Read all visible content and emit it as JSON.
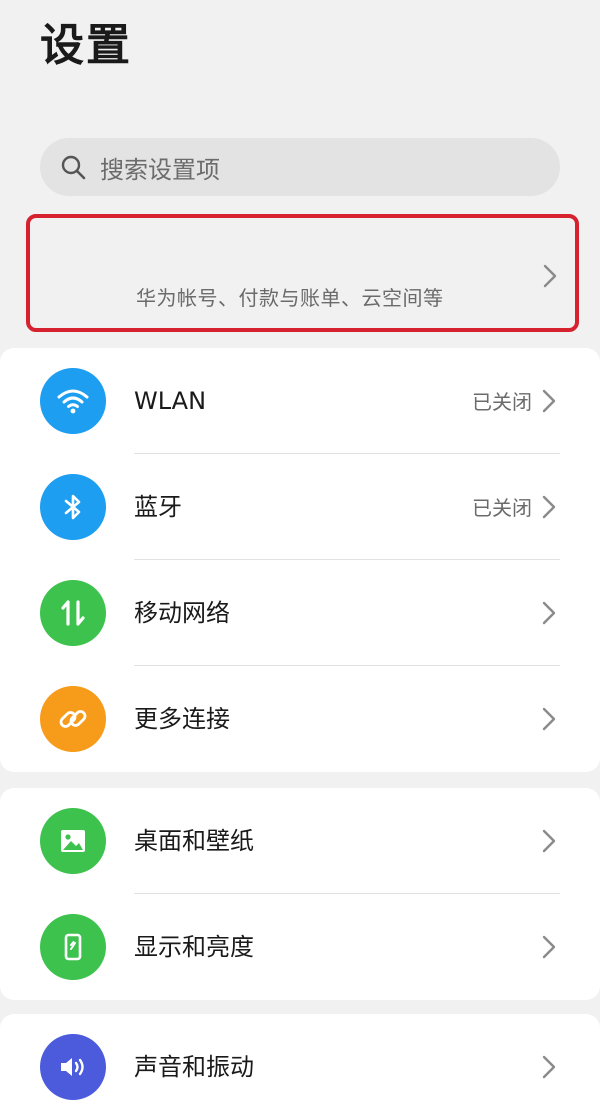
{
  "header": {
    "title": "设置"
  },
  "search": {
    "placeholder": "搜索设置项"
  },
  "account": {
    "subtitle": "华为帐号、付款与账单、云空间等"
  },
  "groups": [
    {
      "items": [
        {
          "label": "WLAN",
          "status": "已关闭",
          "icon": "wifi-icon",
          "color": "#1e9ef0"
        },
        {
          "label": "蓝牙",
          "status": "已关闭",
          "icon": "bluetooth-icon",
          "color": "#1e9ef0"
        },
        {
          "label": "移动网络",
          "status": "",
          "icon": "mobile-data-icon",
          "color": "#3ec24e"
        },
        {
          "label": "更多连接",
          "status": "",
          "icon": "link-icon",
          "color": "#f79b1a"
        }
      ]
    },
    {
      "items": [
        {
          "label": "桌面和壁纸",
          "icon": "wallpaper-icon",
          "color": "#3ec24e"
        },
        {
          "label": "显示和亮度",
          "icon": "display-icon",
          "color": "#3ec24e"
        }
      ]
    },
    {
      "items": [
        {
          "label": "声音和振动",
          "icon": "sound-icon",
          "color": "#4b5bdc"
        }
      ]
    }
  ]
}
